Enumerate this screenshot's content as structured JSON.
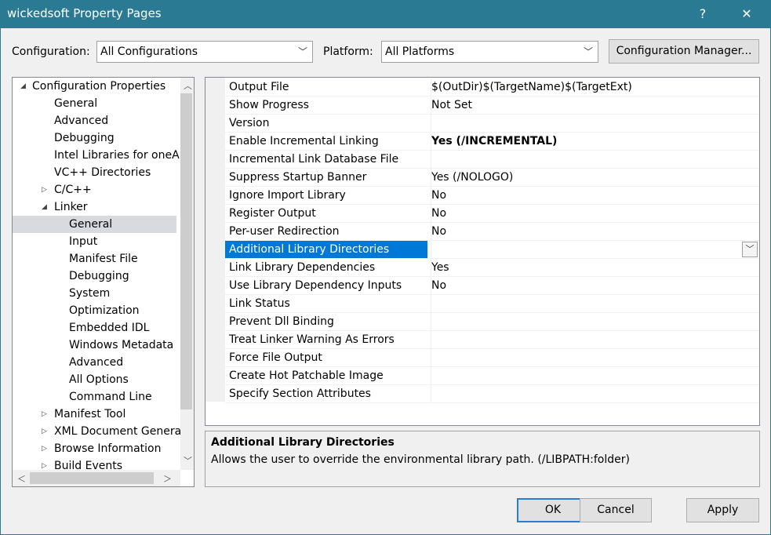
{
  "window": {
    "title": "wickedsoft Property Pages",
    "help_label": "?",
    "close_label": "✕"
  },
  "config": {
    "configuration_label": "Configuration:",
    "configuration_value": "All Configurations",
    "platform_label": "Platform:",
    "platform_value": "All Platforms",
    "manager_button": "Configuration Manager..."
  },
  "tree": {
    "items": [
      {
        "label": "Configuration Properties",
        "twisty": "◢"
      },
      {
        "label": "General"
      },
      {
        "label": "Advanced"
      },
      {
        "label": "Debugging"
      },
      {
        "label": "Intel Libraries for oneAPI"
      },
      {
        "label": "VC++ Directories"
      },
      {
        "label": "C/C++",
        "twisty": "▷"
      },
      {
        "label": "Linker",
        "twisty": "◢"
      },
      {
        "label": "General"
      },
      {
        "label": "Input"
      },
      {
        "label": "Manifest File"
      },
      {
        "label": "Debugging"
      },
      {
        "label": "System"
      },
      {
        "label": "Optimization"
      },
      {
        "label": "Embedded IDL"
      },
      {
        "label": "Windows Metadata"
      },
      {
        "label": "Advanced"
      },
      {
        "label": "All Options"
      },
      {
        "label": "Command Line"
      },
      {
        "label": "Manifest Tool",
        "twisty": "▷"
      },
      {
        "label": "XML Document Generato",
        "twisty": "▷"
      },
      {
        "label": "Browse Information",
        "twisty": "▷"
      },
      {
        "label": "Build Events",
        "twisty": "▷"
      }
    ]
  },
  "properties": [
    {
      "name": "Output File",
      "value": "$(OutDir)$(TargetName)$(TargetExt)"
    },
    {
      "name": "Show Progress",
      "value": "Not Set"
    },
    {
      "name": "Version",
      "value": ""
    },
    {
      "name": "Enable Incremental Linking",
      "value": "Yes (/INCREMENTAL)"
    },
    {
      "name": "Incremental Link Database File",
      "value": ""
    },
    {
      "name": "Suppress Startup Banner",
      "value": "Yes (/NOLOGO)"
    },
    {
      "name": "Ignore Import Library",
      "value": "No"
    },
    {
      "name": "Register Output",
      "value": "No"
    },
    {
      "name": "Per-user Redirection",
      "value": "No"
    },
    {
      "name": "Additional Library Directories",
      "value": ""
    },
    {
      "name": "Link Library Dependencies",
      "value": "Yes"
    },
    {
      "name": "Use Library Dependency Inputs",
      "value": "No"
    },
    {
      "name": "Link Status",
      "value": ""
    },
    {
      "name": "Prevent Dll Binding",
      "value": ""
    },
    {
      "name": "Treat Linker Warning As Errors",
      "value": ""
    },
    {
      "name": "Force File Output",
      "value": ""
    },
    {
      "name": "Create Hot Patchable Image",
      "value": ""
    },
    {
      "name": "Specify Section Attributes",
      "value": ""
    }
  ],
  "description": {
    "title": "Additional Library Directories",
    "text": "Allows the user to override the environmental library path. (/LIBPATH:folder)"
  },
  "buttons": {
    "ok": "OK",
    "cancel": "Cancel",
    "apply": "Apply"
  },
  "colors": {
    "titlebar": "#2b7a93",
    "selection": "#0078d7"
  }
}
